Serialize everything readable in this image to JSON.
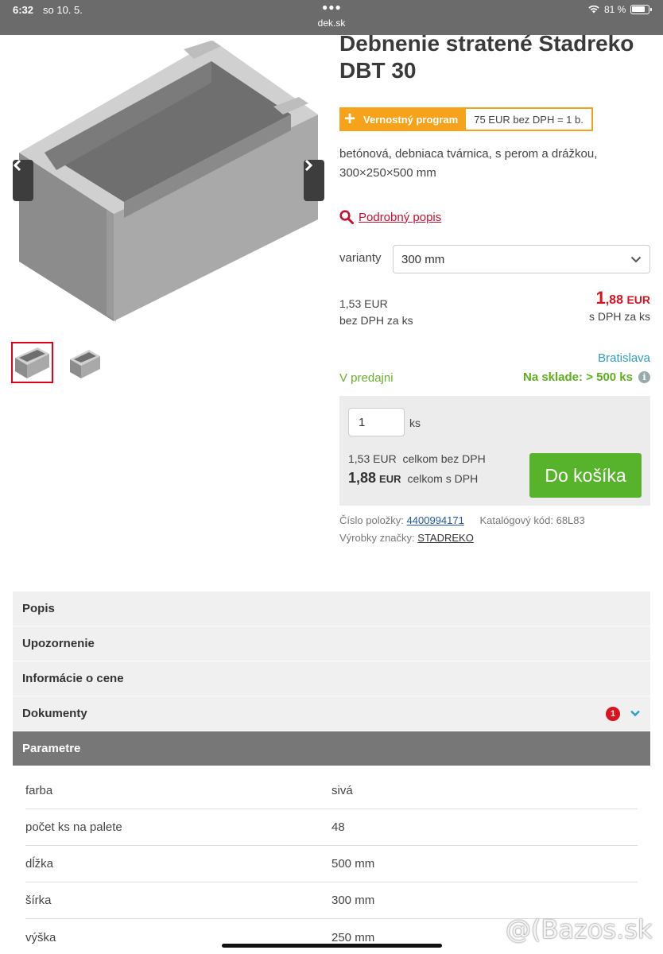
{
  "status_bar": {
    "time": "6:32",
    "date": "so 10. 5.",
    "domain": "dek.sk",
    "battery": "81 %"
  },
  "product": {
    "title": "Debnenie stratené Stadreko DBT 30",
    "loyalty": {
      "label": "Vernostný program",
      "rate": "75 EUR bez DPH = 1 b."
    },
    "short_desc": "betónová, debniaca tvárnica, s perom a drážkou, 300×250×500 mm",
    "detail_link": "Podrobný popis",
    "variant_label": "varianty",
    "variant_selected": "300 mm",
    "price_net": "1,53 EUR",
    "price_net_note": "bez DPH za ks",
    "price_gross_int": "1",
    "price_gross_dec": ",88",
    "price_gross_cur": "EUR",
    "price_gross_note": "s DPH za ks",
    "store": "Bratislava",
    "availability": "V predajni",
    "stock": "Na sklade: > 500 ks",
    "cart": {
      "qty": "1",
      "unit": "ks",
      "sum_net": "1,53 EUR",
      "sum_net_label": "celkom bez DPH",
      "sum_gross": "1,88",
      "sum_gross_cur": "EUR",
      "sum_gross_label": "celkom s DPH",
      "button": "Do košíka"
    },
    "item_no_label": "Číslo položky:",
    "item_no": "4400994171",
    "catalog_code": "Katalógový kód: 68L83",
    "brand_label": "Výrobky značky:",
    "brand": "STADREKO"
  },
  "accordion": [
    {
      "label": "Popis"
    },
    {
      "label": "Upozornenie"
    },
    {
      "label": "Informácie o cene"
    },
    {
      "label": "Dokumenty",
      "badge": "1"
    },
    {
      "label": "Parametre"
    }
  ],
  "params": [
    {
      "k": "farba",
      "v": "sivá"
    },
    {
      "k": "počet ks na palete",
      "v": "48"
    },
    {
      "k": "dĺžka",
      "v": "500 mm"
    },
    {
      "k": "šírka",
      "v": "300 mm"
    },
    {
      "k": "výška",
      "v": "250 mm"
    }
  ],
  "watermark": "@(Bazos.sk",
  "colors": {
    "accent_red": "#d9131f",
    "cart_green": "#58b32c",
    "loyalty_orange": "#f7a21b",
    "store_blue": "#2e9fc4"
  }
}
